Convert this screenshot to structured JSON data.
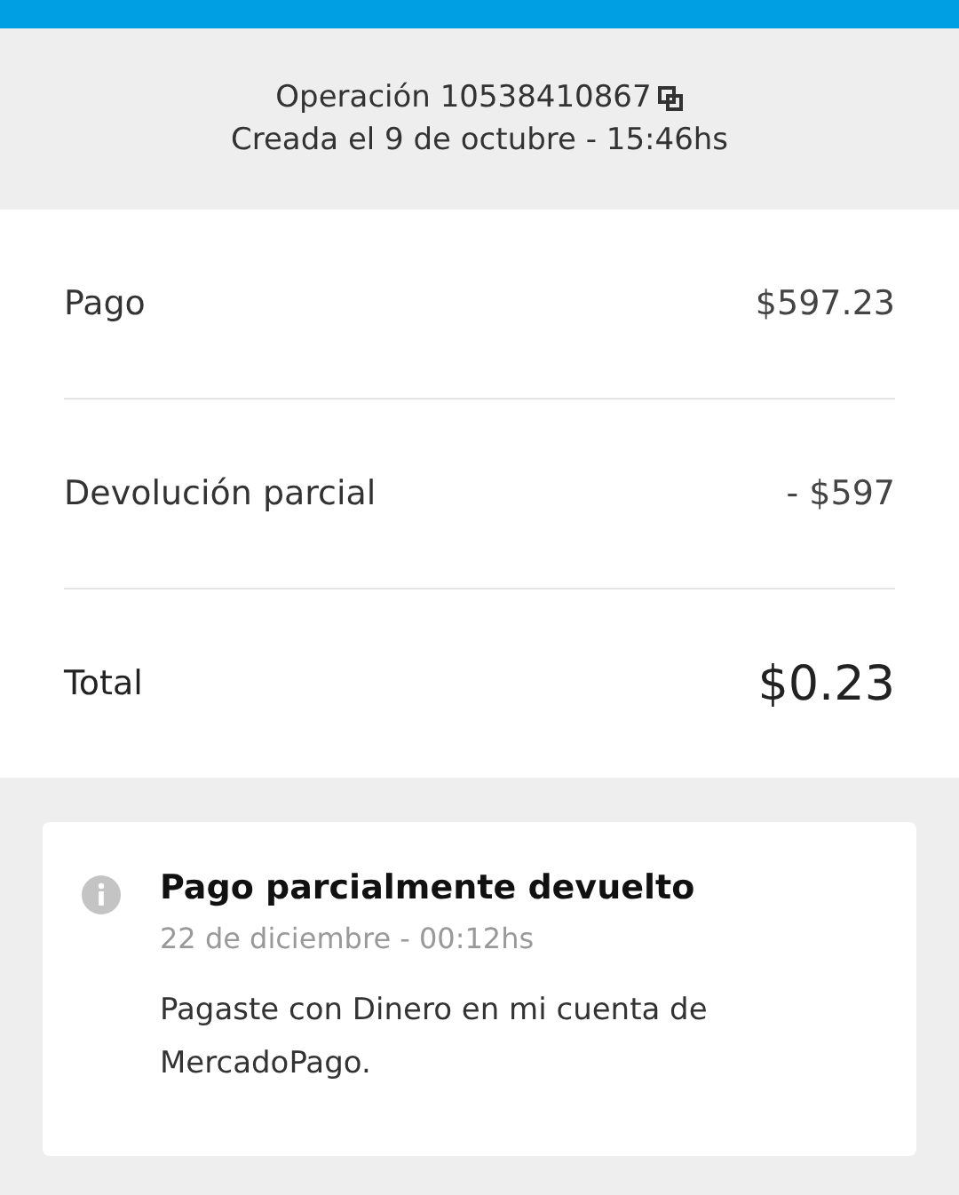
{
  "header": {
    "operation_label": "Operación 10538410867",
    "created": "Creada el 9 de octubre - 15:46hs"
  },
  "rows": [
    {
      "kind": "line",
      "label": "Pago",
      "amount": "$597.23"
    },
    {
      "kind": "line",
      "label": "Devolución parcial",
      "amount": "- $597"
    },
    {
      "kind": "total",
      "label": "Total",
      "amount": "$0.23"
    }
  ],
  "notice": {
    "title": "Pago parcialmente devuelto",
    "date": "22 de diciembre - 00:12hs",
    "message": "Pagaste con Dinero en mi cuenta de MercadoPago."
  }
}
